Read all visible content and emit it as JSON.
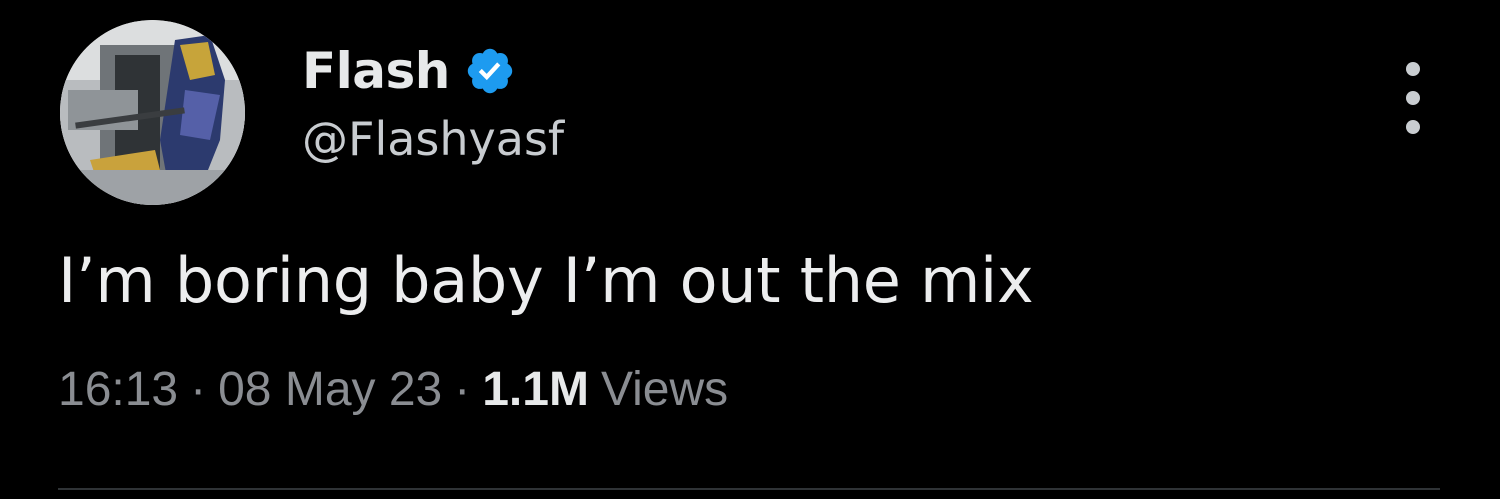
{
  "tweet": {
    "display_name": "Flash",
    "handle": "@Flashyasf",
    "text": "I’m boring baby I’m out the mix",
    "time": "16:13",
    "date": "08 May 23",
    "separator": "·",
    "views_count": "1.1M",
    "views_label": "Views"
  },
  "icons": {
    "verified": "verified-badge-icon",
    "more": "more-options-icon"
  },
  "colors": {
    "background": "#000000",
    "verified_blue": "#1d9bf0",
    "primary_text": "#e7e9ea",
    "secondary_text": "#8a8d92"
  }
}
